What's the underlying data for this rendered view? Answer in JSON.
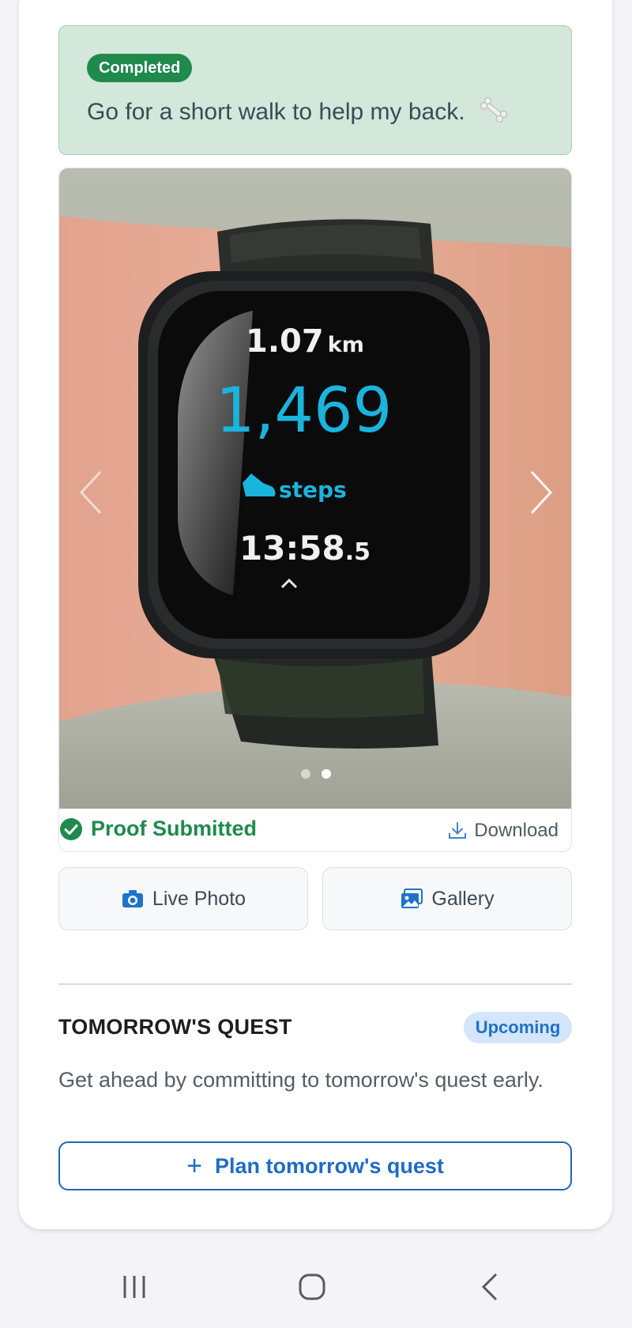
{
  "task": {
    "status_badge": "Completed",
    "text": "Go for a short walk to help my back.",
    "emoji_icon": "bone-icon"
  },
  "proof": {
    "photo_description_icon": "fitness-watch-photo",
    "watch": {
      "distance_value": "1.07",
      "distance_unit": "km",
      "steps_value": "1,469",
      "steps_label": "steps",
      "time": "13:58",
      "time_fraction": ".5"
    },
    "carousel": {
      "total": 2,
      "active_index": 1
    },
    "status_text": "Proof Submitted",
    "download_label": "Download"
  },
  "actions": {
    "live_photo_label": "Live Photo",
    "gallery_label": "Gallery"
  },
  "tomorrow": {
    "title": "TOMORROW'S QUEST",
    "badge": "Upcoming",
    "description": "Get ahead by committing to tomorrow's quest early.",
    "plan_button_label": "Plan tomorrow's quest"
  },
  "colors": {
    "completed_green": "#1f8a4c",
    "task_bg": "#d3e8da",
    "accent_blue": "#1f6bc4",
    "upcoming_bg": "#d4e6fb",
    "watch_cyan": "#1ab4dc"
  }
}
